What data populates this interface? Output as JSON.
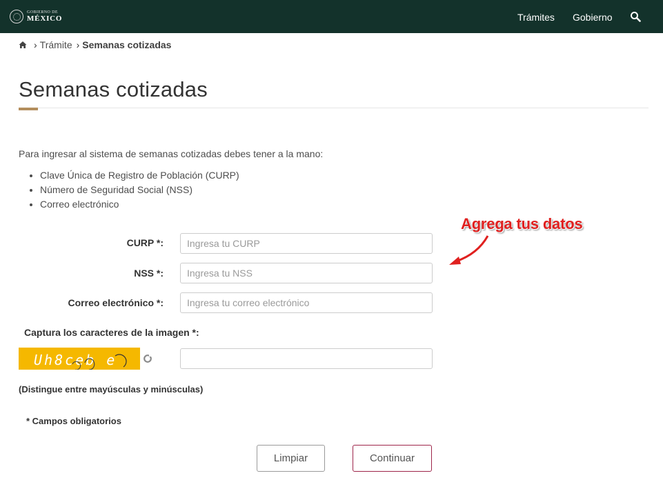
{
  "header": {
    "logo_small": "GOBIERNO DE",
    "logo_big": "MÉXICO",
    "nav": [
      "Trámites",
      "Gobierno"
    ],
    "search_icon": "search-icon",
    "background_color": "#13322b"
  },
  "breadcrumb": {
    "home_icon": "home-icon",
    "items": [
      "Trámite",
      "Semanas cotizadas"
    ]
  },
  "page": {
    "title": "Semanas cotizadas",
    "accent_color": "#b38e5d",
    "intro": "Para ingresar al sistema de semanas cotizadas debes tener a la mano:",
    "requirements": [
      "Clave Única de Registro de Población (CURP)",
      "Número de Seguridad Social (NSS)",
      "Correo electrónico"
    ]
  },
  "annotation": {
    "text": "Agrega tus datos",
    "color": "#e0201f"
  },
  "form": {
    "curp": {
      "label": "CURP *:",
      "placeholder": "Ingresa tu CURP",
      "value": ""
    },
    "nss": {
      "label": "NSS *:",
      "placeholder": "Ingresa tu NSS",
      "value": ""
    },
    "email": {
      "label": "Correo electrónico *:",
      "placeholder": "Ingresa tu correo electrónico",
      "value": ""
    },
    "captcha": {
      "label": "Captura los caracteres de la imagen *:",
      "image_text": "Uh8ceb e",
      "refresh_icon": "refresh-icon",
      "value": "",
      "hint": "(Distingue entre mayúsculas y minúsculas)"
    },
    "required_note": "* Campos obligatorios",
    "buttons": {
      "clear": "Limpiar",
      "submit": "Continuar",
      "submit_color": "#9d2449"
    }
  }
}
